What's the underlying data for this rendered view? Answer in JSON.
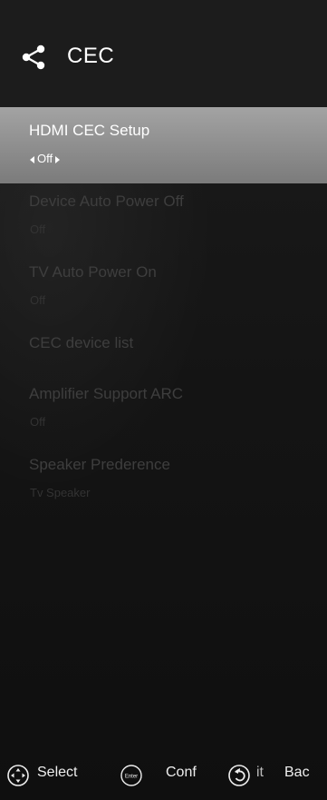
{
  "header": {
    "title": "CEC",
    "icon": "share-icon"
  },
  "menu": [
    {
      "label": "HDMI CEC Setup",
      "value": "Off",
      "selected": true
    },
    {
      "label": "Device Auto Power Off",
      "value": "Off",
      "selected": false
    },
    {
      "label": "TV Auto Power On",
      "value": "Off",
      "selected": false
    },
    {
      "label": "CEC device list",
      "value": "",
      "selected": false
    },
    {
      "label": "Amplifier Support ARC",
      "value": "Off",
      "selected": false
    },
    {
      "label": "Speaker Prederence",
      "value": "Tv Speaker",
      "selected": false
    }
  ],
  "footer": {
    "select_label": "Select",
    "select_icon": "dpad-icon",
    "enter_icon_text": "Enter",
    "confirm_label": "Conf",
    "back_icon": "back-icon",
    "exit_label": "it",
    "back_label": "Bac"
  },
  "colors": {
    "selected_bar": "#8d8d8d",
    "background": "#151515"
  }
}
